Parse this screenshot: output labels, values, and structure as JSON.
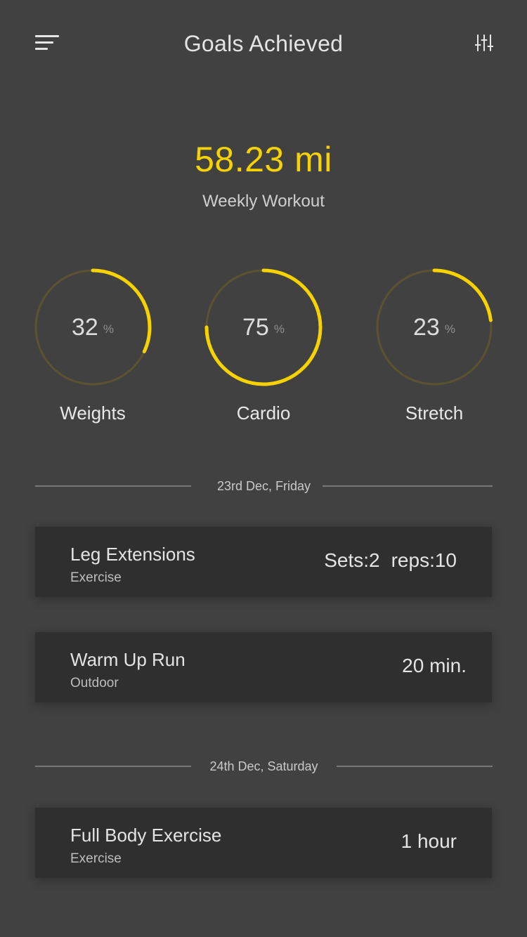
{
  "header": {
    "title": "Goals Achieved",
    "menu_icon": "menu-sort-icon",
    "filter_icon": "sliders-icon"
  },
  "summary": {
    "distance": "58.23 mi",
    "label": "Weekly Workout"
  },
  "colors": {
    "background": "#414141",
    "accent": "#f6d200",
    "track": "#5a5232",
    "card": "#2f2f2f"
  },
  "goals": [
    {
      "label": "Weights",
      "value": "32",
      "unit": "%",
      "progress": 0.32
    },
    {
      "label": "Cardio",
      "value": "75",
      "unit": "%",
      "progress": 0.75
    },
    {
      "label": "Stretch",
      "value": "23",
      "unit": "%",
      "progress": 0.23
    }
  ],
  "days": [
    {
      "date": "23rd Dec, Friday",
      "entries": [
        {
          "title": "Leg Extensions",
          "category": "Exercise",
          "sets": "Sets:2",
          "reps": "reps:10"
        },
        {
          "title": "Warm Up Run",
          "category": "Outdoor",
          "detail": "20 min."
        }
      ]
    },
    {
      "date": "24th Dec, Saturday",
      "entries": [
        {
          "title": "Full Body Exercise",
          "category": "Exercise",
          "detail": "1 hour"
        }
      ]
    }
  ]
}
